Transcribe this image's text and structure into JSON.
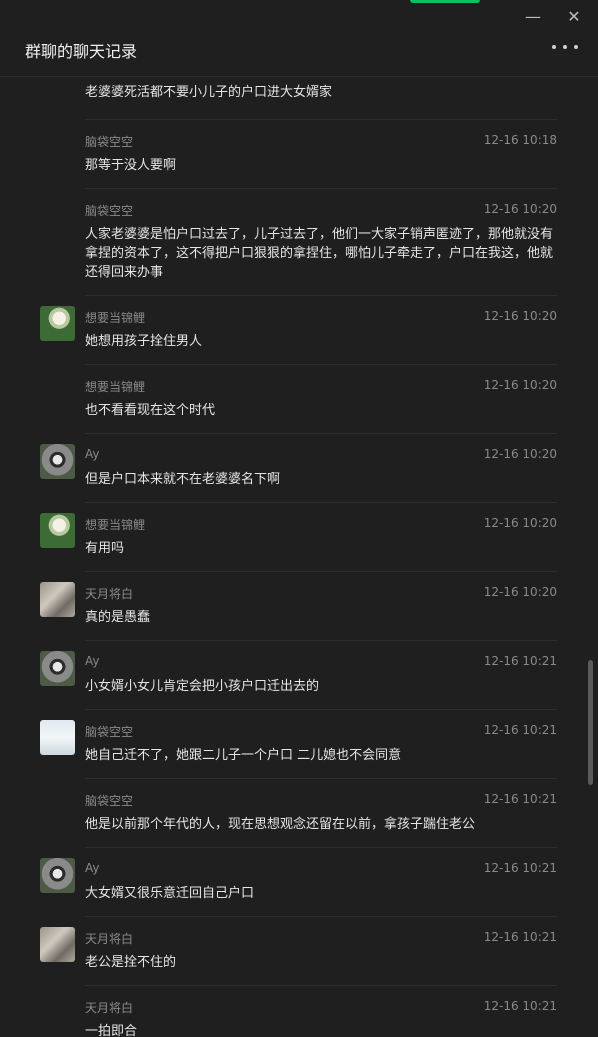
{
  "window": {
    "title": "群聊的聊天记录",
    "minimize": "—",
    "close": "✕",
    "more_icon": "more-dots-icon"
  },
  "messages": [
    {
      "name": "",
      "time": "",
      "text": "老婆婆死活都不要小儿子的户口进大女婿家",
      "avatar": ""
    },
    {
      "name": "脑袋空空",
      "time": "12-16 10:18",
      "text": "那等于没人要啊",
      "avatar": ""
    },
    {
      "name": "脑袋空空",
      "time": "12-16 10:20",
      "text": "人家老婆婆是怕户口过去了，儿子过去了，他们一大家子销声匿迹了，那他就没有拿捏的资本了，这不得把户口狠狠的拿捏住，哪怕儿子牵走了，户口在我这，他就还得回来办事",
      "avatar": ""
    },
    {
      "name": "想要当锦鲤",
      "time": "12-16 10:20",
      "text": "她想用孩子拴住男人",
      "avatar": "flower"
    },
    {
      "name": "想要当锦鲤",
      "time": "12-16 10:20",
      "text": "也不看看现在这个时代",
      "avatar": ""
    },
    {
      "name": "Ay",
      "time": "12-16 10:20",
      "text": "但是户口本来就不在老婆婆名下啊",
      "avatar": "panda"
    },
    {
      "name": "想要当锦鲤",
      "time": "12-16 10:20",
      "text": "有用吗",
      "avatar": "flower"
    },
    {
      "name": "天月将白",
      "time": "12-16 10:20",
      "text": "真的是愚蠢",
      "avatar": "cat"
    },
    {
      "name": "Ay",
      "time": "12-16 10:21",
      "text": "小女婿小女儿肯定会把小孩户口迁出去的",
      "avatar": "panda"
    },
    {
      "name": "脑袋空空",
      "time": "12-16 10:21",
      "text": "她自己迁不了，她跟二儿子一个户口 二儿媳也不会同意",
      "avatar": "sky"
    },
    {
      "name": "脑袋空空",
      "time": "12-16 10:21",
      "text": "他是以前那个年代的人，现在思想观念还留在以前，拿孩子踹住老公",
      "avatar": ""
    },
    {
      "name": "Ay",
      "time": "12-16 10:21",
      "text": "大女婿又很乐意迁回自己户口",
      "avatar": "panda"
    },
    {
      "name": "天月将白",
      "time": "12-16 10:21",
      "text": "老公是拴不住的",
      "avatar": "cat"
    },
    {
      "name": "天月将白",
      "time": "12-16 10:21",
      "text": "一拍即合",
      "avatar": ""
    }
  ]
}
